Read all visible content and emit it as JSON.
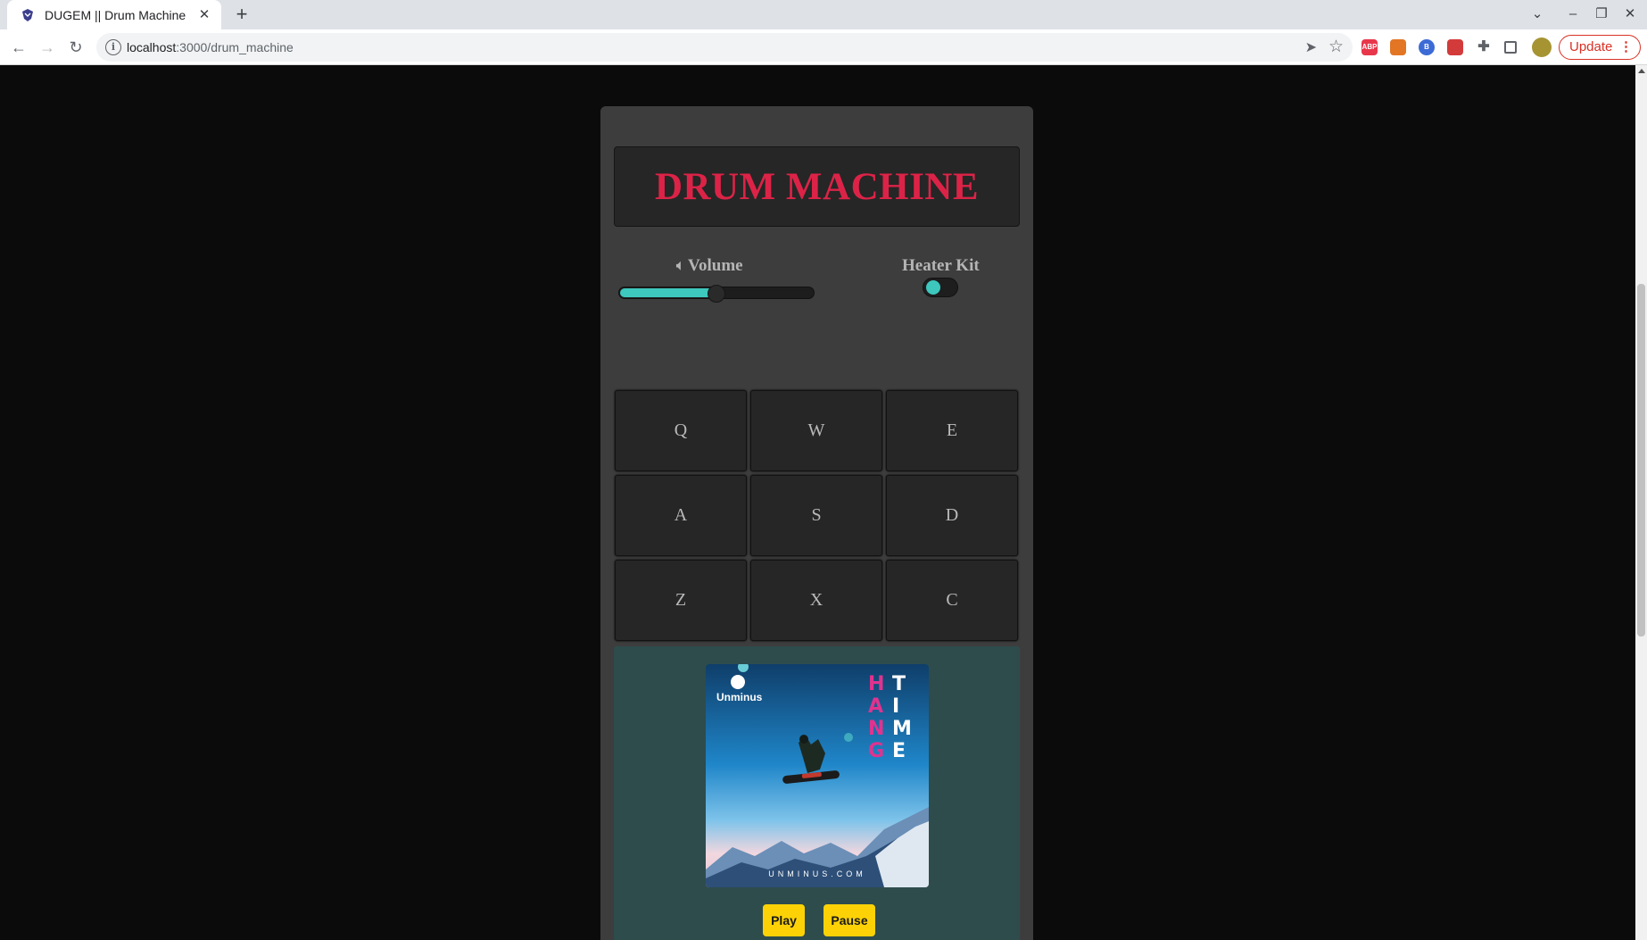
{
  "browser": {
    "tab_title": "DUGEM || Drum Machine",
    "url_host": "localhost",
    "url_path": ":3000/drum_machine",
    "update_label": "Update",
    "extensions": [
      {
        "name": "adblock-plus-icon",
        "label": "ABP",
        "color": "#e8374b"
      },
      {
        "name": "metamask-icon",
        "label": "",
        "color": "#e27625"
      },
      {
        "name": "extension-b-icon",
        "label": "B",
        "color": "#3c6bd6"
      },
      {
        "name": "extension-red-icon",
        "label": "",
        "color": "#d33b3b"
      }
    ]
  },
  "app": {
    "title": "DRUM MACHINE",
    "volume_label": "Volume",
    "volume_value": 0.5,
    "kit_label": "Heater Kit",
    "kit_toggle_on": false,
    "pads": [
      "Q",
      "W",
      "E",
      "A",
      "S",
      "D",
      "Z",
      "X",
      "C"
    ],
    "player": {
      "cover_brand": "Unminus",
      "cover_word_a": "HANG",
      "cover_word_b": "TIME",
      "cover_site": "UNMINUS.COM",
      "play_label": "Play",
      "pause_label": "Pause"
    }
  },
  "colors": {
    "accent": "#3dc7bd",
    "title_red": "#dc2347",
    "button_yellow": "#fcd207"
  }
}
